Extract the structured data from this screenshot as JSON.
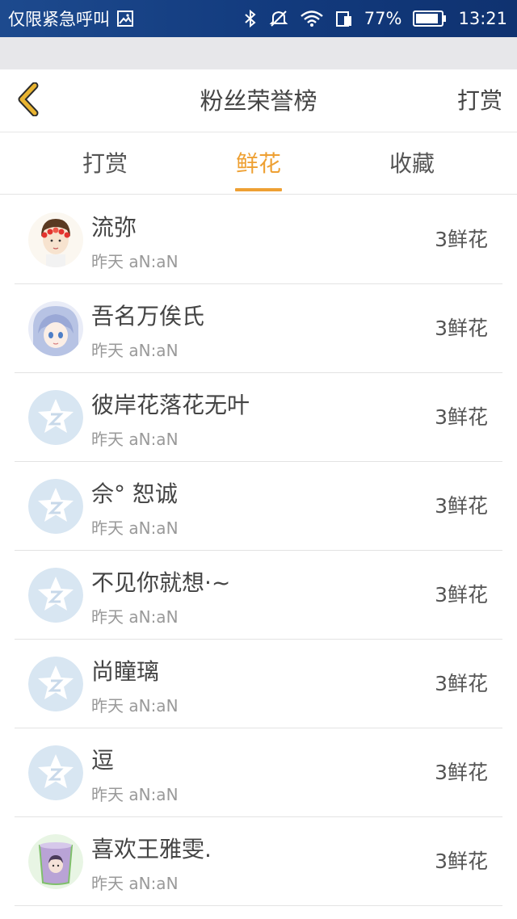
{
  "status_bar": {
    "carrier": "仅限紧急呼叫",
    "battery": "77%",
    "time": "13:21",
    "icons": [
      "image-icon",
      "bluetooth-icon",
      "mute-icon",
      "wifi-icon",
      "sim-icon",
      "battery-icon"
    ]
  },
  "header": {
    "title": "粉丝荣誉榜",
    "action": "打赏",
    "back_icon": "chevron-left-icon",
    "back_color": "#e9b431"
  },
  "tabs": [
    {
      "label": "打赏",
      "active": false
    },
    {
      "label": "鲜花",
      "active": true
    },
    {
      "label": "收藏",
      "active": false
    }
  ],
  "accent_color": "#eea033",
  "fans": [
    {
      "name": "流弥",
      "time": "昨天 aN:aN",
      "count": "3鲜花",
      "avatar": "photo-girl-avatar"
    },
    {
      "name": "吾名万俟氏",
      "time": "昨天 aN:aN",
      "count": "3鲜花",
      "avatar": "anime-avatar"
    },
    {
      "name": "彼岸花落花无叶",
      "time": "昨天 aN:aN",
      "count": "3鲜花",
      "avatar": "default-star-avatar"
    },
    {
      "name": "佘° 恕诚",
      "time": "昨天 aN:aN",
      "count": "3鲜花",
      "avatar": "default-star-avatar"
    },
    {
      "name": "不见你就想·~",
      "time": "昨天 aN:aN",
      "count": "3鲜花",
      "avatar": "default-star-avatar"
    },
    {
      "name": "尚瞳璃",
      "time": "昨天 aN:aN",
      "count": "3鲜花",
      "avatar": "default-star-avatar"
    },
    {
      "name": "逗",
      "time": "昨天 aN:aN",
      "count": "3鲜花",
      "avatar": "default-star-avatar"
    },
    {
      "name": "喜欢王雅雯.",
      "time": "昨天 aN:aN",
      "count": "3鲜花",
      "avatar": "cup-avatar"
    }
  ]
}
